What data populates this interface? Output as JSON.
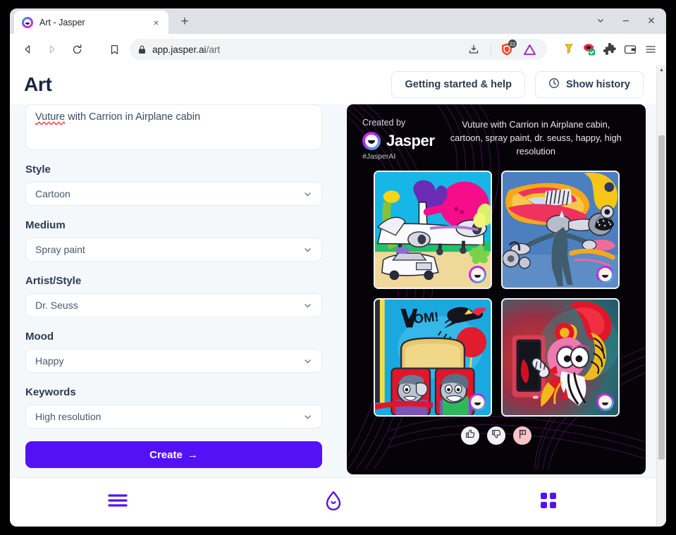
{
  "browser": {
    "tab": {
      "title": "Art - Jasper",
      "favicon": "jasper-logo-icon",
      "close_label": "×"
    },
    "new_tab_label": "+",
    "window_controls": {
      "chevron": "chevron-down-icon",
      "minimize": "minimize-icon",
      "close": "close-icon"
    },
    "nav": {
      "back": "back-arrow-icon",
      "forward": "forward-arrow-icon",
      "reload": "reload-icon",
      "bookmark": "bookmark-icon"
    },
    "omnibox": {
      "lock": "lock-icon",
      "domain": "app.jasper.ai",
      "path": "/art",
      "share": "share-download-icon"
    },
    "extensions": [
      "brave-shield-icon",
      "warning-triangle-icon",
      "highlighter-icon",
      "grammarly-icon",
      "puzzle-extension-icon",
      "wallet-icon",
      "menu-icon"
    ],
    "brave_badge": "22"
  },
  "header": {
    "title": "Art",
    "getting_started_label": "Getting started & help",
    "show_history_label": "Show history",
    "history_icon": "clock-icon"
  },
  "form": {
    "prompt": {
      "misspelled": "Vuture",
      "rest": " with Carrion in Airplane cabin"
    },
    "fields": [
      {
        "label": "Style",
        "value": "Cartoon"
      },
      {
        "label": "Medium",
        "value": "Spray paint"
      },
      {
        "label": "Artist/Style",
        "value": "Dr. Seuss"
      },
      {
        "label": "Mood",
        "value": "Happy"
      },
      {
        "label": "Keywords",
        "value": "High resolution"
      }
    ],
    "create_label": "Create",
    "create_arrow": "→"
  },
  "art": {
    "created_by": "Created by",
    "brand": "Jasper",
    "hashtag": "#JasperAI",
    "prompt_summary": "Vuture with Carrion in Airplane cabin, cartoon, spray paint, dr. seuss, happy, high resolution",
    "thumbnails": [
      {
        "name": "airplane-character-on-runway"
      },
      {
        "name": "character-with-jet-engine"
      },
      {
        "name": "cabin-seats-with-passengers"
      },
      {
        "name": "pink-bird-character-at-door"
      }
    ],
    "feedback": [
      {
        "name": "thumbs-up",
        "icon": "thumbs-up-icon",
        "active": false
      },
      {
        "name": "thumbs-down",
        "icon": "thumbs-down-icon",
        "active": false
      },
      {
        "name": "flag",
        "icon": "flag-icon",
        "active": true
      }
    ]
  },
  "bottom_nav": [
    {
      "name": "menu",
      "icon": "hamburger-menu-icon"
    },
    {
      "name": "home",
      "icon": "home-icon"
    },
    {
      "name": "apps",
      "icon": "grid-apps-icon"
    }
  ],
  "colors": {
    "accent": "#5312f5",
    "panel_bg": "#f5f8fb",
    "art_bg": "#050308",
    "title": "#1c2541",
    "flag_active": "#f9c3c8"
  }
}
